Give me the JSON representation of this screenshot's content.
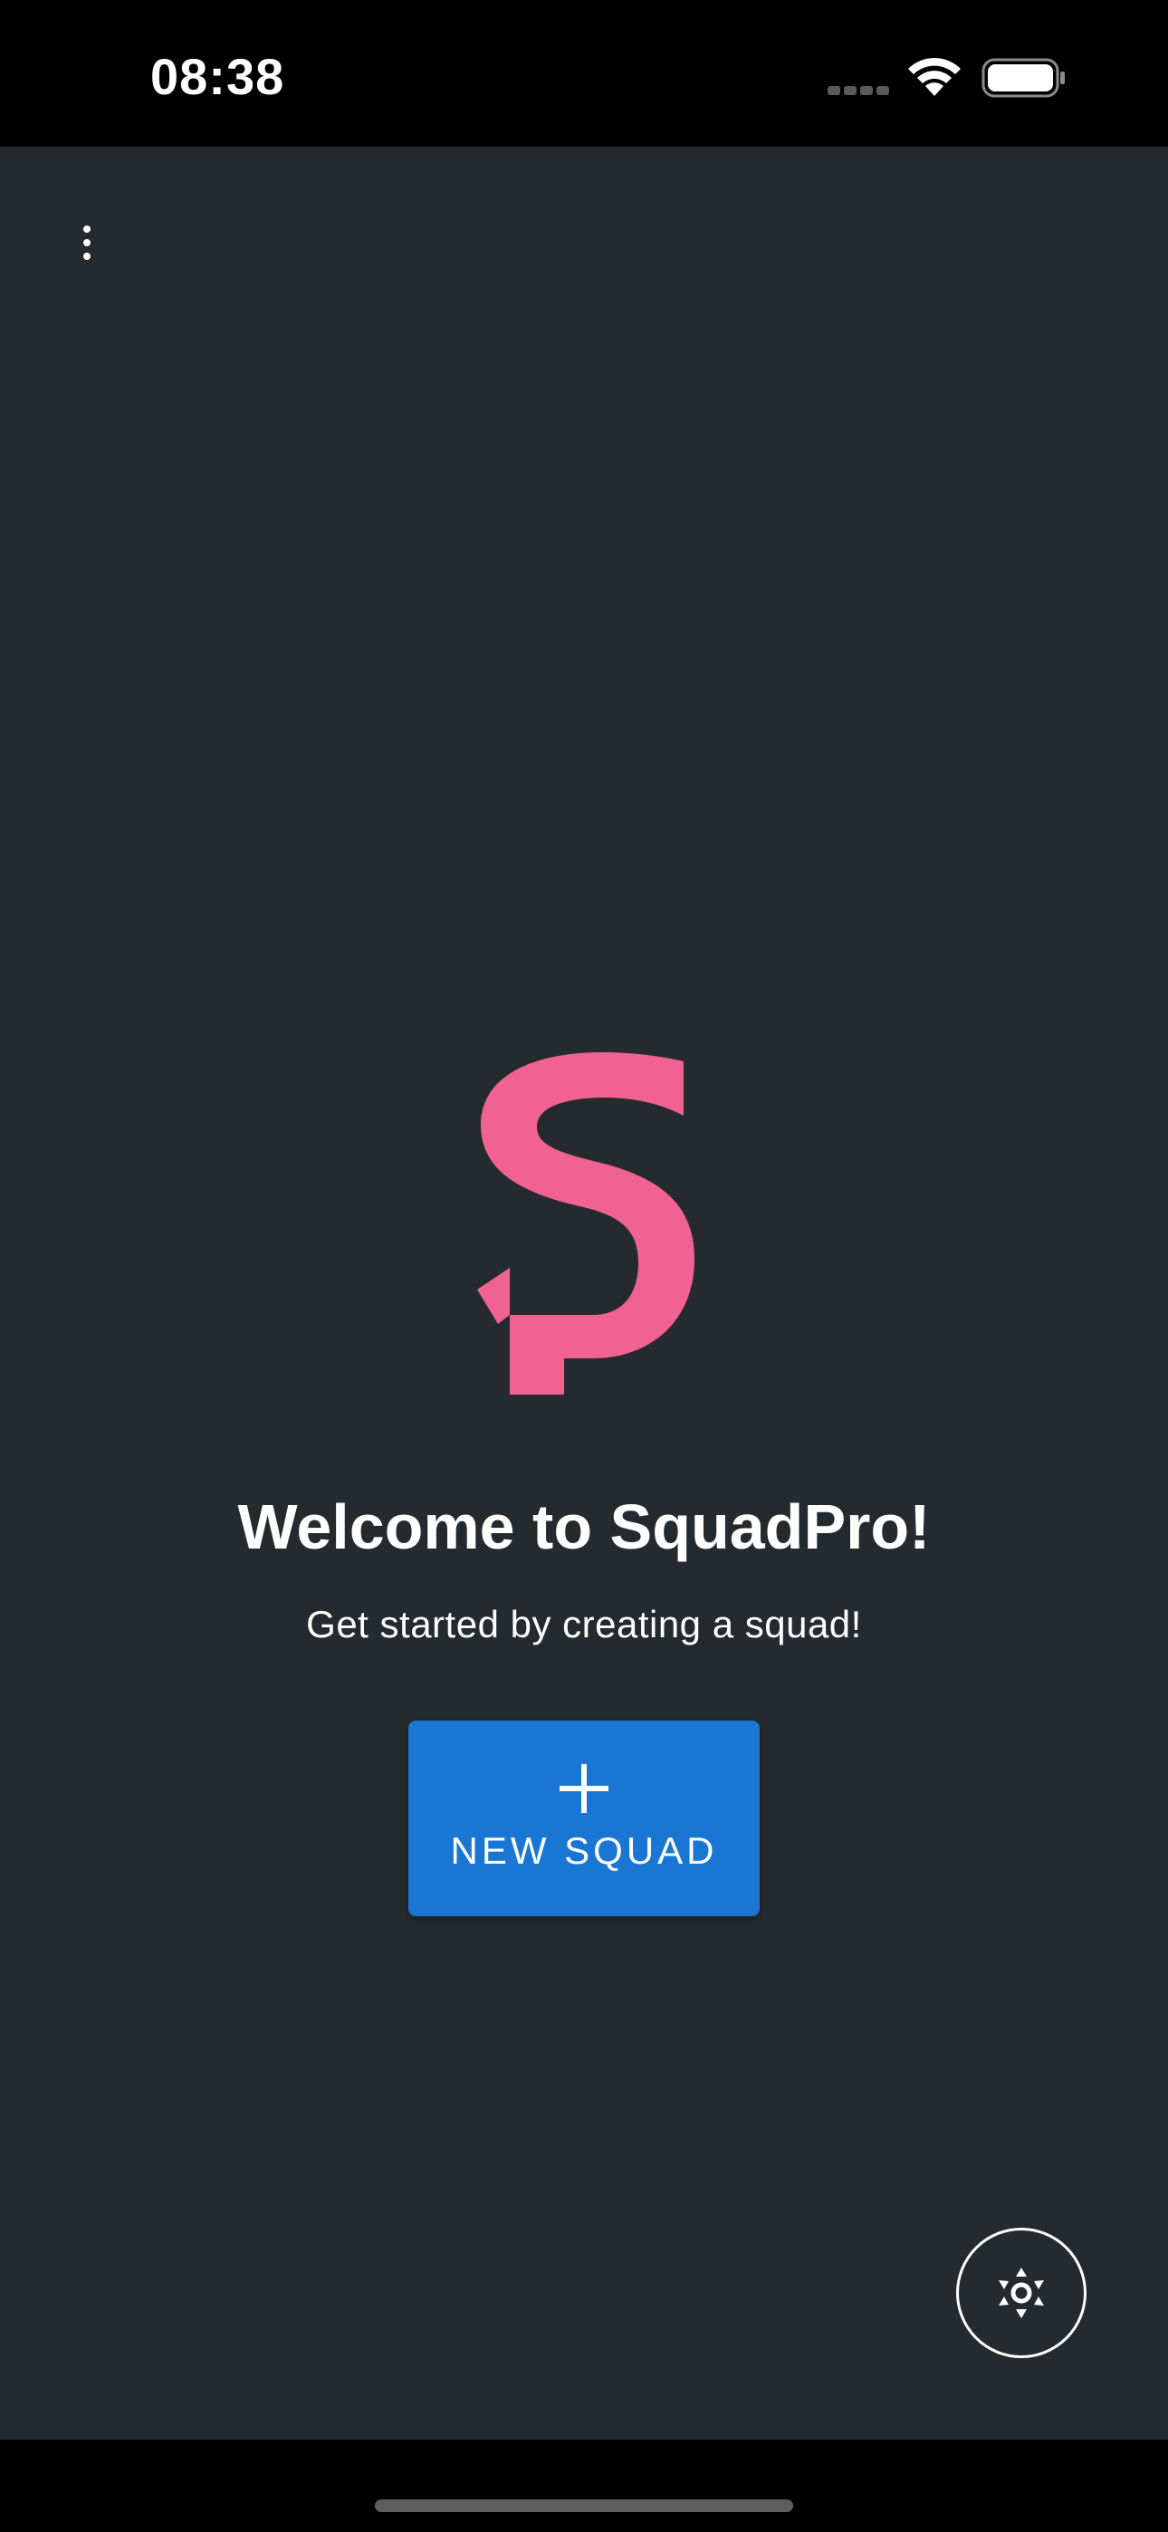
{
  "status_bar": {
    "time": "08:38",
    "signal_icon": "cellular-signal-icon",
    "wifi_icon": "wifi-icon",
    "battery_icon": "battery-icon"
  },
  "header": {
    "menu_icon": "more-vertical-icon"
  },
  "main": {
    "logo_icon": "squadpro-logo",
    "title": "Welcome to SquadPro!",
    "subtitle": "Get started by creating a squad!",
    "new_squad_button": {
      "icon": "plus-icon",
      "label": "NEW SQUAD"
    }
  },
  "fab": {
    "icon": "brightness-icon"
  },
  "colors": {
    "background": "#252a2e",
    "status_bar": "#000000",
    "accent_pink": "#f06292",
    "primary_blue": "#1976d2",
    "text": "#ffffff"
  }
}
